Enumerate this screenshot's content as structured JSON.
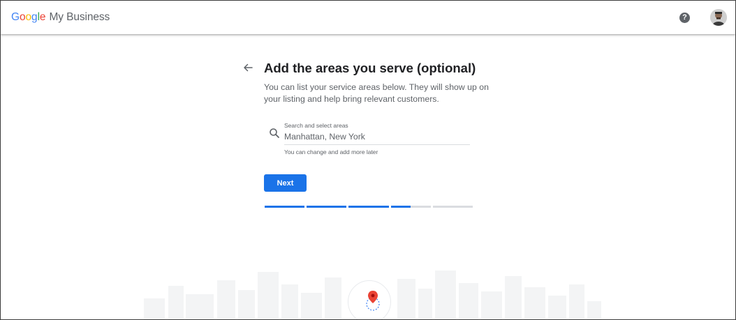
{
  "header": {
    "logo_google": [
      "G",
      "o",
      "o",
      "g",
      "l",
      "e"
    ],
    "logo_product": "My Business",
    "help_label": "?",
    "brand_colors": [
      "#4285F4",
      "#EA4335",
      "#FBBC05",
      "#4285F4",
      "#34A853",
      "#EA4335"
    ]
  },
  "main": {
    "title": "Add the areas you serve (optional)",
    "subtitle": "You can list your service areas below. They will show up on your listing and help bring relevant customers.",
    "search": {
      "label": "Search and select areas",
      "value": "Manhattan, New York",
      "helper": "You can change and add more later"
    },
    "next_label": "Next",
    "progress": {
      "segments": 5,
      "fills": [
        1,
        1,
        1,
        0.5,
        0
      ]
    }
  },
  "colors": {
    "accent": "#1a73e8",
    "track": "#dadce0",
    "pin": "#ea4335"
  }
}
